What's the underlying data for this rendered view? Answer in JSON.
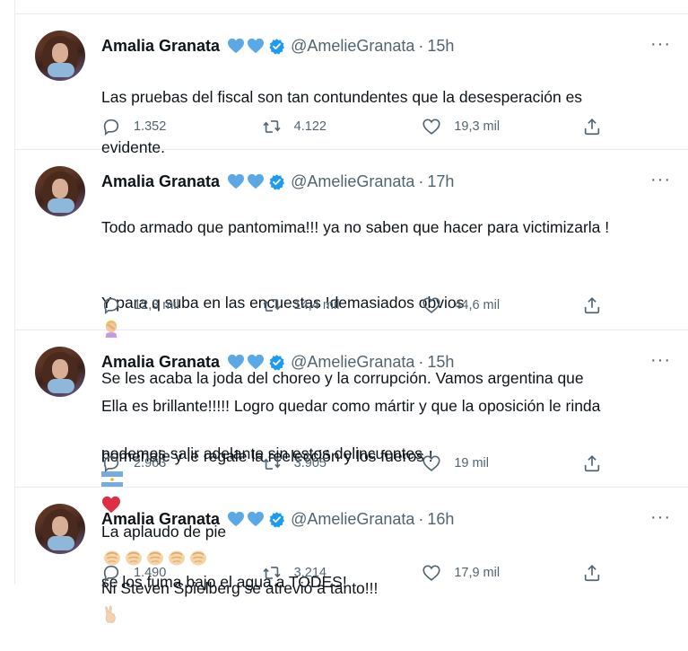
{
  "tweets": [
    {
      "name": "Amalia Granata",
      "handle": "@AmelieGranata",
      "separator": "·",
      "time": "15h",
      "more": "···",
      "text_lines": [
        "Las pruebas del fiscal son tan contundentes que la  desesperación es",
        "evidente."
      ],
      "replies": "1.352",
      "retweets": "4.122",
      "likes": "19,3 mil",
      "emojis": []
    },
    {
      "name": "Amalia Granata",
      "handle": "@AmelieGranata",
      "separator": "·",
      "time": "17h",
      "more": "···",
      "text_lines": [
        "Todo armado que pantomima!!! ya no saben que hacer para victimizarla !",
        "Y para q suba en las encuestas !demasiados obvios",
        "Se les acaba la joda del choreo y la corrupción. Vamos argentina que",
        "podemos salir adelante sin estos delincuentes"
      ],
      "replies": "12,3 mil",
      "retweets": "14,4 mil",
      "likes": "44,6 mil",
      "emojis": [
        "woman-facepalming",
        "argentina-flag",
        "red-heart"
      ]
    },
    {
      "name": "Amalia Granata",
      "handle": "@AmelieGranata",
      "separator": "·",
      "time": "15h",
      "more": "···",
      "text_lines": [
        "Ella es brillante!!!!! Logro quedar como mártir y que la oposición  le rinda",
        "homenaje y le regale la reelección y los fueros !",
        "La aplaudo de pie",
        "se los fuma bajo el agua a TODES!"
      ],
      "replies": "2.963",
      "retweets": "3.905",
      "likes": "19 mil",
      "emojis": [
        "clapping-hands",
        "clapping-hands",
        "clapping-hands",
        "clapping-hands",
        "clapping-hands"
      ]
    },
    {
      "name": "Amalia Granata",
      "handle": "@AmelieGranata",
      "separator": "·",
      "time": "16h",
      "more": "···",
      "text_lines": [
        "Ni Steven Spielberg se atrevió a tanto!!!"
      ],
      "replies": "1.490",
      "retweets": "3.214",
      "likes": "17,9 mil",
      "emojis": [
        "victory-hand"
      ]
    }
  ],
  "colors": {
    "text": "#0f1419",
    "muted": "#536471",
    "heart_blue": "#5aa9e6",
    "verified_blue": "#1d9bf0",
    "divider": "#e6ecf0"
  }
}
